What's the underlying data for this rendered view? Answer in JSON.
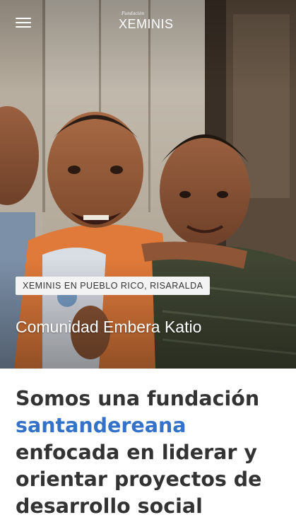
{
  "header": {
    "menu_icon": "hamburger-menu-icon",
    "logo_small": "Fundación",
    "logo_main": "XEMINIS"
  },
  "hero": {
    "location_tag": "XEMINIS EN PUEBLO RICO, RISARALDA",
    "title": "Comunidad Embera Katio"
  },
  "intro": {
    "part1": "Somos una fundación",
    "highlight": "santandereana",
    "part2": "enfocada en liderar y orientar proyectos de desarrollo social"
  },
  "colors": {
    "accent": "#3471c8",
    "text": "#333333",
    "tag_bg": "#f3f3f3"
  }
}
